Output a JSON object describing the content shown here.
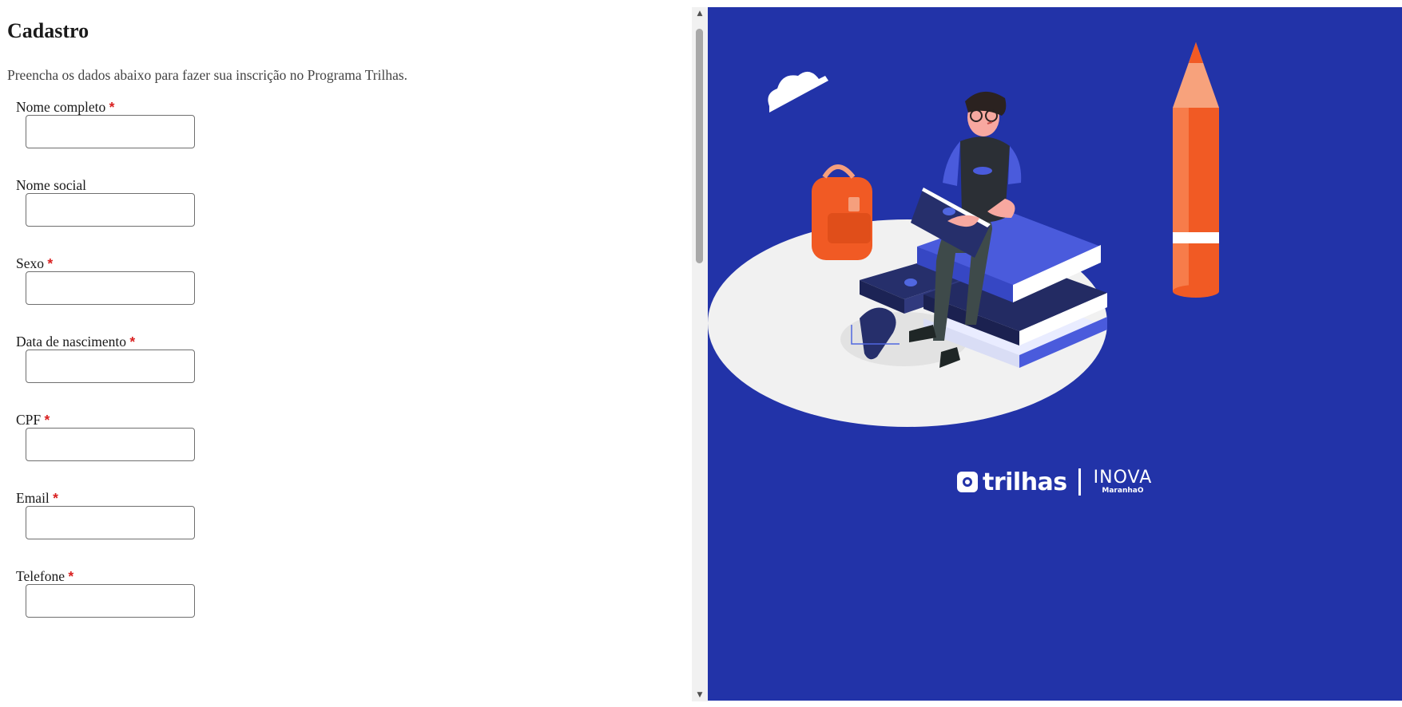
{
  "form": {
    "title": "Cadastro",
    "subtitle": "Preencha os dados abaixo para fazer sua inscrição no Programa Trilhas.",
    "fields": [
      {
        "label": "Nome completo",
        "required": "*",
        "value": ""
      },
      {
        "label": "Nome social",
        "required": "",
        "value": ""
      },
      {
        "label": "Sexo",
        "required": "*",
        "value": ""
      },
      {
        "label": "Data de nascimento",
        "required": "*",
        "value": ""
      },
      {
        "label": "CPF",
        "required": "*",
        "value": ""
      },
      {
        "label": "Email",
        "required": "*",
        "value": ""
      },
      {
        "label": "Telefone",
        "required": "*",
        "value": ""
      }
    ]
  },
  "branding": {
    "brand_name": "trilhas",
    "partner_name": "INOVA",
    "partner_sub": "MaranhaO",
    "panel_color": "#2233a8"
  },
  "icons": [
    "scroll-up-arrow-icon",
    "scroll-down-arrow-icon",
    "trilhas-logo-icon"
  ]
}
